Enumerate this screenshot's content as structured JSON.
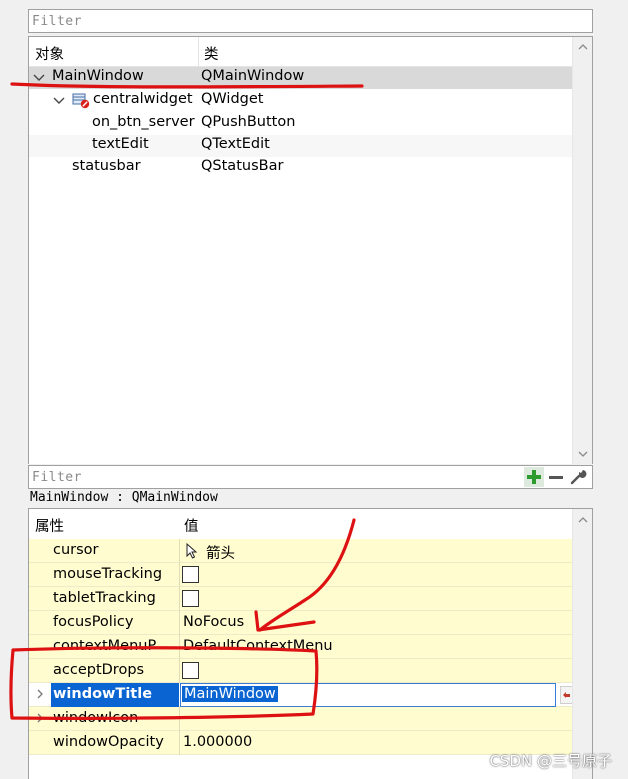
{
  "object_inspector": {
    "filter_placeholder": "Filter",
    "header": {
      "object": "对象",
      "class": "类"
    },
    "rows": [
      {
        "name": "MainWindow",
        "class": "QMainWindow"
      },
      {
        "name": "centralwidget",
        "class": "QWidget"
      },
      {
        "name": "on_btn_server",
        "class": "QPushButton"
      },
      {
        "name": "textEdit",
        "class": "QTextEdit"
      },
      {
        "name": "statusbar",
        "class": "QStatusBar"
      }
    ]
  },
  "property_editor": {
    "filter_placeholder": "Filter",
    "caption": "MainWindow : QMainWindow",
    "header": {
      "property": "属性",
      "value": "值"
    },
    "rows": [
      {
        "name": "cursor",
        "value": "箭头"
      },
      {
        "name": "mouseTracking",
        "checked": false
      },
      {
        "name": "tabletTracking",
        "checked": false
      },
      {
        "name": "focusPolicy",
        "value": "NoFocus"
      },
      {
        "name": "contextMenuP",
        "value": "DefaultContextMenu"
      },
      {
        "name": "acceptDrops",
        "checked": false
      },
      {
        "name": "windowTitle",
        "value": "MainWindow"
      },
      {
        "name": "windowIcon",
        "value": ""
      },
      {
        "name": "windowOpacity",
        "value": "1.000000"
      }
    ]
  },
  "watermark": "CSDN @三号原子",
  "colors": {
    "annotation": "#dd1111",
    "selection": "#0a64d2",
    "property_row": "#fffcd0"
  },
  "icons": [
    "chevron-down-icon",
    "chevron-right-icon",
    "widget-layout-icon",
    "arrow-cursor-icon",
    "add-icon",
    "remove-icon",
    "wrench-icon",
    "reset-icon"
  ]
}
